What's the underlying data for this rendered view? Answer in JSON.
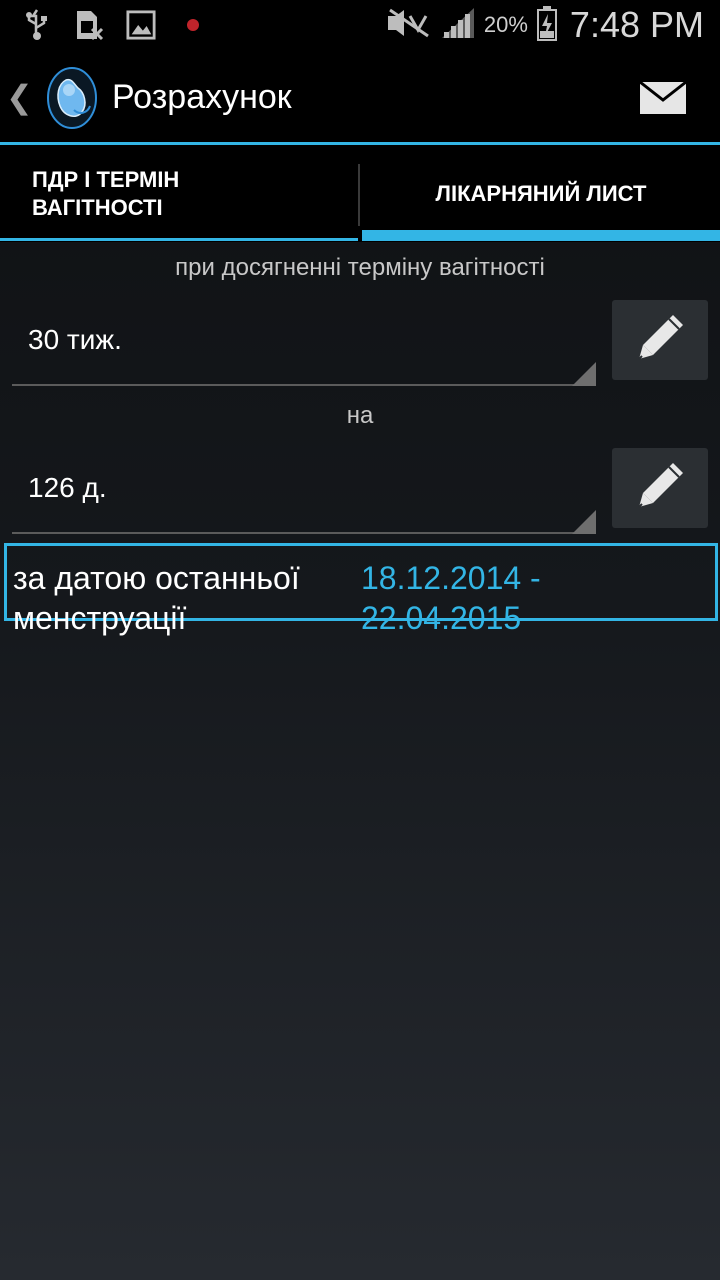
{
  "status_bar": {
    "icons": [
      "usb-icon",
      "sim-icon",
      "gallery-icon",
      "recording-dot-icon"
    ],
    "battery_percent": "20%",
    "time": "7:48 PM",
    "right_icons": [
      "silent-icon",
      "signal-icon",
      "battery-charging-icon"
    ]
  },
  "action_bar": {
    "title": "Розрахунок",
    "icons": [
      "back-chevron-icon",
      "app-logo-icon",
      "mail-icon"
    ]
  },
  "tabs": [
    {
      "label": "ПДР І ТЕРМІН ВАГІТНОСТІ",
      "selected": false
    },
    {
      "label": "ЛІКАРНЯНИЙ ЛИСТ",
      "selected": true
    }
  ],
  "form": {
    "caption_term": "при досягненні терміну вагітності",
    "term_value": "30 тиж.",
    "caption_for": "на",
    "duration_value": "126 д.",
    "edit_icon": "pencil-icon"
  },
  "result": {
    "label": "за датою останньої менструації",
    "value": "18.12.2014 - 22.04.2015"
  },
  "colors": {
    "accent": "#33b5e5",
    "background": "#15181c",
    "bar": "#000000"
  }
}
